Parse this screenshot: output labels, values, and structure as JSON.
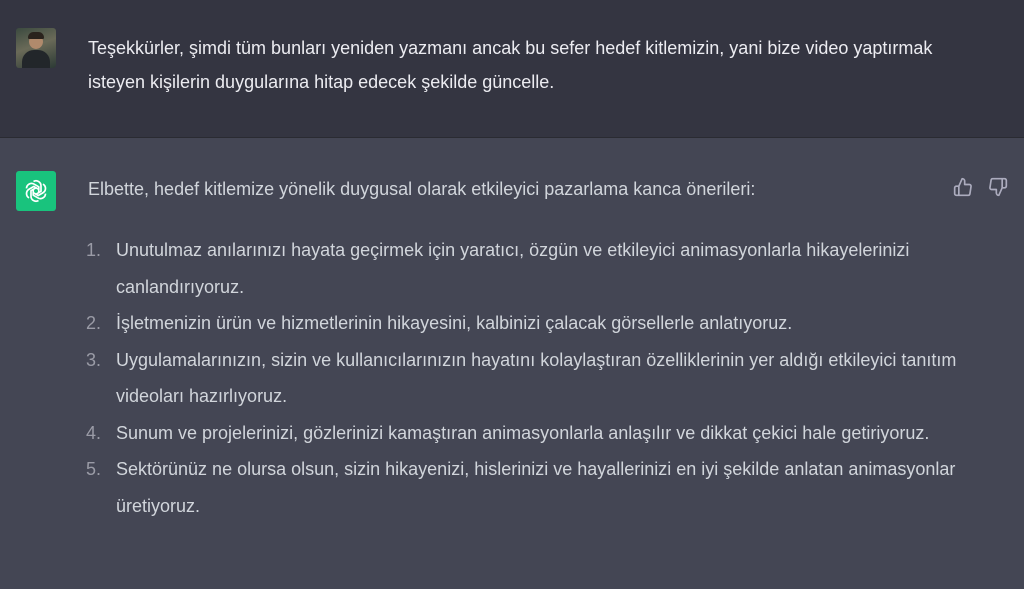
{
  "user_message": {
    "text": "Teşekkürler, şimdi tüm bunları yeniden yazmanı ancak bu sefer hedef kitlemizin, yani bize video yaptırmak isteyen kişilerin duygularına hitap edecek şekilde güncelle."
  },
  "assistant_message": {
    "intro": "Elbette, hedef kitlemize yönelik duygusal olarak etkileyici pazarlama kanca önerileri:",
    "items": [
      {
        "number": "1.",
        "text": "Unutulmaz anılarınızı hayata geçirmek için yaratıcı, özgün ve etkileyici animasyonlarla hikayelerinizi canlandırıyoruz."
      },
      {
        "number": "2.",
        "text": "İşletmenizin ürün ve hizmetlerinin hikayesini, kalbinizi çalacak görsellerle anlatıyoruz."
      },
      {
        "number": "3.",
        "text": "Uygulamalarınızın, sizin ve kullanıcılarınızın hayatını kolaylaştıran özelliklerinin yer aldığı etkileyici tanıtım videoları hazırlıyoruz."
      },
      {
        "number": "4.",
        "text": "Sunum ve projelerinizi, gözlerinizi kamaştıran animasyonlarla anlaşılır ve dikkat çekici hale getiriyoruz."
      },
      {
        "number": "5.",
        "text": "Sektörünüz ne olursa olsun, sizin hikayenizi, hislerinizi ve hayallerinizi en iyi şekilde anlatan animasyonlar üretiyoruz."
      }
    ]
  },
  "icons": {
    "user_avatar": "user-avatar",
    "assistant_avatar": "openai-logo-icon",
    "thumbs_up": "thumbs-up-icon",
    "thumbs_down": "thumbs-down-icon"
  },
  "colors": {
    "user_bg": "#343541",
    "assistant_bg": "#444654",
    "brand_green": "#19c37d",
    "text_primary": "#ececf1",
    "text_secondary": "#d1d5db"
  }
}
